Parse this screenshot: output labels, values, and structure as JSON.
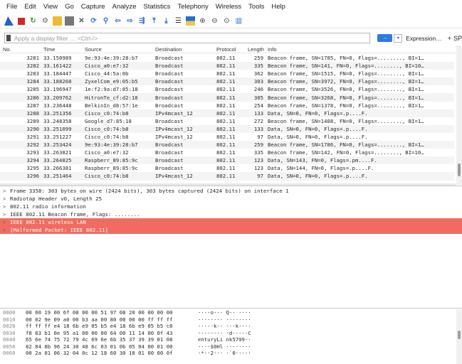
{
  "menu": [
    "File",
    "Edit",
    "View",
    "Go",
    "Capture",
    "Analyze",
    "Statistics",
    "Telephony",
    "Wireless",
    "Tools",
    "Help"
  ],
  "toolbar": {
    "icons": [
      "shark-fin-icon",
      "stop-icon",
      "restart-icon",
      "options-icon",
      "open-icon",
      "save-icon",
      "close-file-icon",
      "reload-icon",
      "find-icon",
      "back-icon",
      "forward-icon",
      "go-to-packet-icon",
      "first-packet-icon",
      "last-packet-icon",
      "autoscroll-icon",
      "colorize-icon",
      "zoom-in-icon",
      "zoom-out-icon",
      "zoom-normal-icon",
      "resize-columns-icon"
    ],
    "glyphs": {
      "restart": "↻",
      "options": "⚙",
      "close": "✕",
      "reload": "⟳",
      "find": "⚲",
      "back": "⇦",
      "forward": "⇨",
      "goto": "⇶",
      "first": "⤒",
      "last": "⤓",
      "autoscroll": "☰",
      "zoom_in": "⊕",
      "zoom_out": "⊖",
      "zoom_normal": "⊙",
      "resize": "▥"
    }
  },
  "filter": {
    "placeholder": "Apply a display filter … <Ctrl-/>",
    "apply_label": "→",
    "dropdown_label": "▾",
    "expression_label": "Expression…",
    "add_label": "+",
    "add_suffix": "SP"
  },
  "columns": [
    "No.",
    "Time",
    "Source",
    "Destination",
    "Protocol",
    "Length",
    "Info"
  ],
  "packets": [
    {
      "no": "3281",
      "time": "33.150989",
      "src": "9e:93:4e:39:28:b7",
      "dst": "Broadcast",
      "proto": "802.11",
      "len": "259",
      "info": "Beacon frame, SN=1785, FN=0, Flags=........, BI=1…"
    },
    {
      "no": "3282",
      "time": "33.161422",
      "src": "Cisco_a0:e7:32",
      "dst": "Broadcast",
      "proto": "802.11",
      "len": "335",
      "info": "Beacon frame, SN=141, FN=0, Flags=........, BI=10…"
    },
    {
      "no": "3283",
      "time": "33.184447",
      "src": "Cisco_44:5a:0b",
      "dst": "Broadcast",
      "proto": "802.11",
      "len": "362",
      "info": "Beacon frame, SN=1515, FN=0, Flags=........, BI=1…"
    },
    {
      "no": "3284",
      "time": "33.188268",
      "src": "ZyxelCom_e9:05:b5",
      "dst": "Broadcast",
      "proto": "802.11",
      "len": "303",
      "info": "Beacon frame, SN=3972, FN=0, Flags=........, BI=1…"
    },
    {
      "no": "3285",
      "time": "33.196947",
      "src": "1e:f2:9a:d7:85:18",
      "dst": "Broadcast",
      "proto": "802.11",
      "len": "246",
      "info": "Beacon frame, SN=3526, FN=0, Flags=........, BI=1…"
    },
    {
      "no": "3286",
      "time": "33.209762",
      "src": "HitronTe_cf:d2:18",
      "dst": "Broadcast",
      "proto": "802.11",
      "len": "305",
      "info": "Beacon frame, SN=3268, FN=0, Flags=........, BI=1…"
    },
    {
      "no": "3287",
      "time": "33.236448",
      "src": "BelkinIn_d8:57:1e",
      "dst": "Broadcast",
      "proto": "802.11",
      "len": "254",
      "info": "Beacon frame, SN=1378, FN=0, Flags=........, BI=1…"
    },
    {
      "no": "3288",
      "time": "33.251356",
      "src": "Cisco_c0:74:b8",
      "dst": "IPv4mcast_12",
      "proto": "802.11",
      "len": "133",
      "info": "Data, SN=0, FN=0, Flags=.p....F."
    },
    {
      "no": "3289",
      "time": "33.248358",
      "src": "Google_d7:85:18",
      "dst": "Broadcast",
      "proto": "802.11",
      "len": "272",
      "info": "Beacon frame, SN=1408, FN=0, Flags=........, BI=1…"
    },
    {
      "no": "3290",
      "time": "33.251099",
      "src": "Cisco_c0:74:b8",
      "dst": "IPv4mcast_12",
      "proto": "802.11",
      "len": "133",
      "info": "Data, SN=0, FN=0, Flags=.p....F."
    },
    {
      "no": "3291",
      "time": "33.251227",
      "src": "Cisco_c0:74:b8",
      "dst": "IPv4mcast_12",
      "proto": "802.11",
      "len": "97",
      "info": "Data, SN=0, FN=0, Flags=.p....F."
    },
    {
      "no": "3292",
      "time": "33.253424",
      "src": "9e:93:4e:39:28:b7",
      "dst": "Broadcast",
      "proto": "802.11",
      "len": "259",
      "info": "Beacon frame, SN=1786, FN=0, Flags=........, BI=1…"
    },
    {
      "no": "3293",
      "time": "33.263821",
      "src": "Cisco_a0:e7:32",
      "dst": "Broadcast",
      "proto": "802.11",
      "len": "335",
      "info": "Beacon frame, SN=142, FN=0, Flags=........, BI=10…"
    },
    {
      "no": "3294",
      "time": "33.264825",
      "src": "Raspberr_89:85:9c",
      "dst": "Broadcast",
      "proto": "802.11",
      "len": "123",
      "info": "Data, SN=143, FN=0, Flags=.pm....F."
    },
    {
      "no": "3295",
      "time": "33.266381",
      "src": "Raspberr_89:85:9c",
      "dst": "Broadcast",
      "proto": "802.11",
      "len": "123",
      "info": "Data, SN=144, FN=0, Flags=.p....F."
    },
    {
      "no": "3296",
      "time": "33.251464",
      "src": "Cisco_c0:74:b8",
      "dst": "IPv4mcast_12",
      "proto": "802.11",
      "len": "97",
      "info": "Data, SN=0, FN=0, Flags=.p....F."
    }
  ],
  "details": [
    {
      "arrow": ">",
      "text": "Frame 3358: 303 bytes on wire (2424 bits), 303 bytes captured (2424 bits) on interface 1",
      "error": false
    },
    {
      "arrow": ">",
      "text": "Radiotap Header v0, Length 25",
      "error": false
    },
    {
      "arrow": ">",
      "text": "802.11 radio information",
      "error": false
    },
    {
      "arrow": ">",
      "text": "IEEE 802.11 Beacon frame, Flags: ........",
      "error": false
    },
    {
      "arrow": ">",
      "text": "IEEE 802.11 wireless LAN",
      "error": true
    },
    {
      "arrow": ">",
      "text": "[Malformed Packet: IEEE 802.11]",
      "error": true
    }
  ],
  "hex": [
    {
      "off": "0000",
      "bytes": "00 00 19 00 6f 08 00 00  51 97 08 20 00 00 00 00",
      "ascii": "····o··· Q·· ····"
    },
    {
      "off": "0010",
      "bytes": "00 02 9e 09 a0 00 b3 aa  00 80 00 00 00 ff ff ff",
      "ascii": "········ ········"
    },
    {
      "off": "0020",
      "bytes": "ff ff ff e4 18 6b e9 05  b5 e4 18 6b e9 05 b5 c0",
      "ascii": "·····k·· ···k····"
    },
    {
      "off": "0030",
      "bytes": "f8 83 b1 0e 95 a1 00 00  00 64 00 11 14 00 0f 43",
      "ascii": "········ ·d·····C"
    },
    {
      "off": "0040",
      "bytes": "65 6e 74 75 72 79 4c 69  6e 6b 35 37 39 39 01 08",
      "ascii": "enturyLi nk5799··"
    },
    {
      "off": "0050",
      "bytes": "82 84 8b 96 24 30 48 6c  03 01 0b 05 04 00 01 00",
      "ascii": "····$0Hl ········"
    },
    {
      "off": "0060",
      "bytes": "00 2a 01 06 32 04 0c 12  18 60 30 18 01 00 00 0f",
      "ascii": "·*··2··· ·`0·····"
    }
  ]
}
